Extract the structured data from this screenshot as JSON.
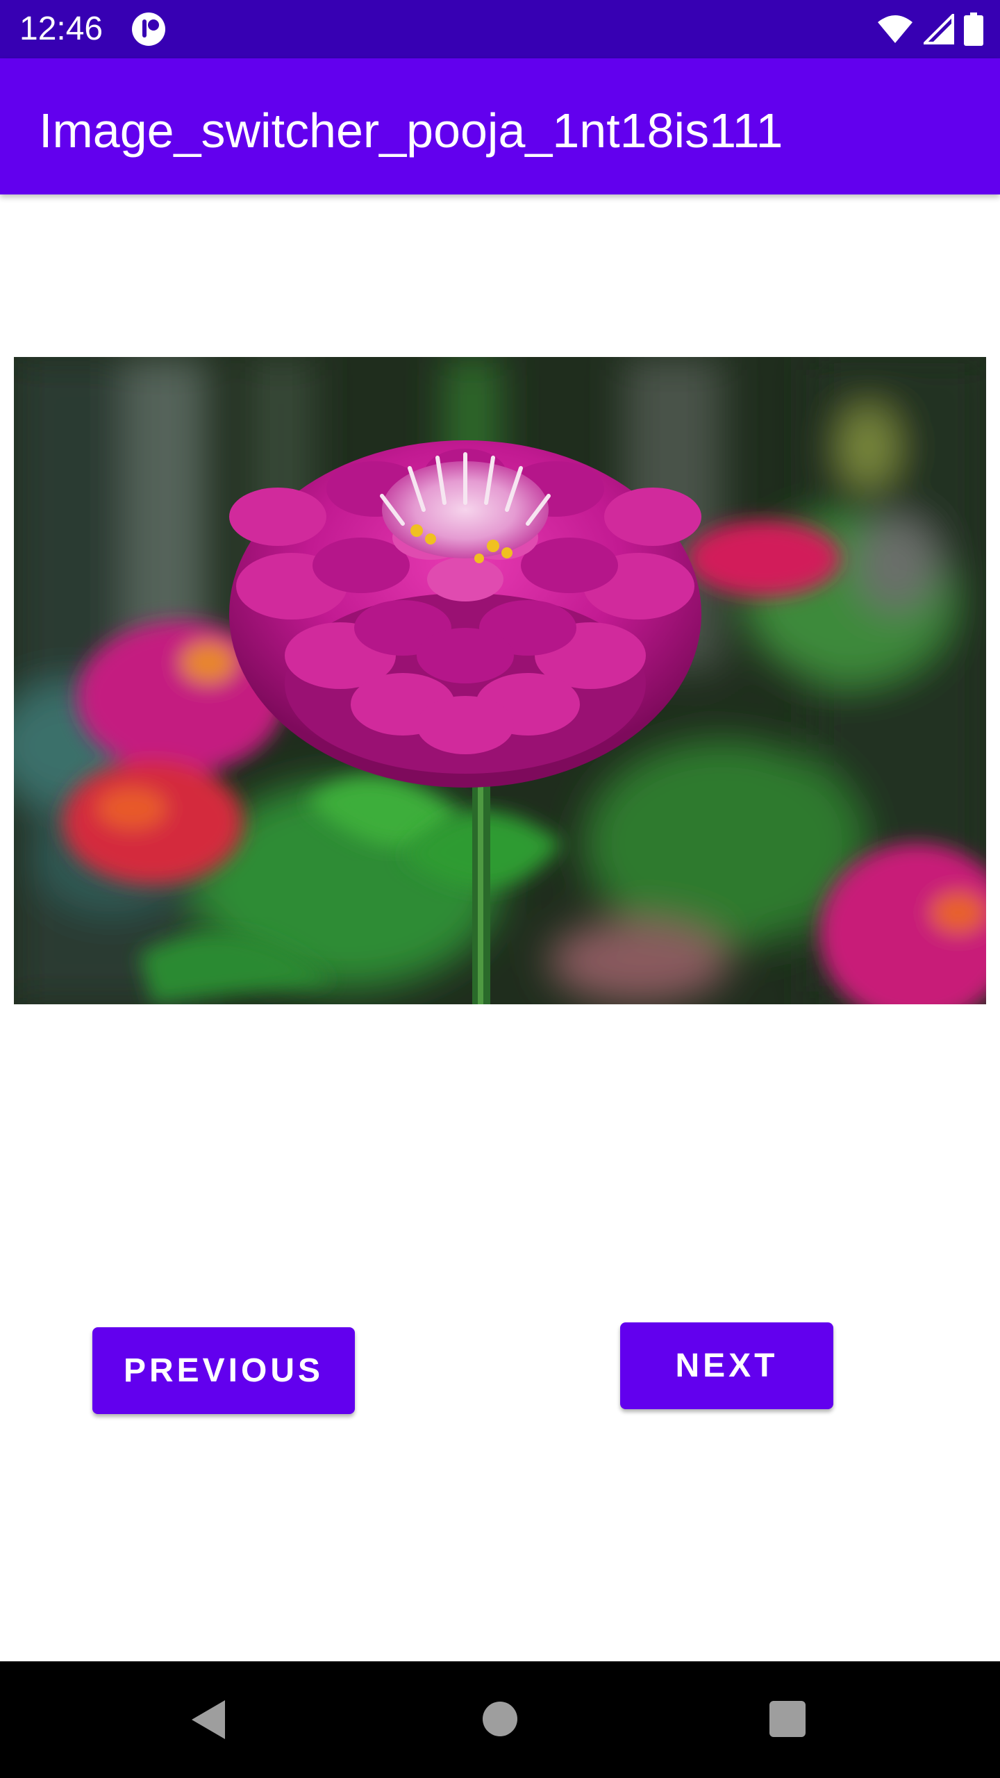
{
  "status_bar": {
    "time": "12:46",
    "icons": [
      "notification-app-icon",
      "wifi-icon",
      "cellular-signal-icon",
      "battery-icon"
    ]
  },
  "app_bar": {
    "title": "Image_switcher_pooja_1nt18is111"
  },
  "image_switcher": {
    "image_icon": "flower-photo"
  },
  "buttons": {
    "previous_label": "PREVIOUS",
    "next_label": "NEXT"
  },
  "nav_bar": {
    "icons": [
      "back-icon",
      "home-icon",
      "recents-icon"
    ]
  },
  "colors": {
    "status_bar": "#3700b3",
    "primary": "#6200ee",
    "background": "#ffffff",
    "nav_bar": "#000000"
  }
}
